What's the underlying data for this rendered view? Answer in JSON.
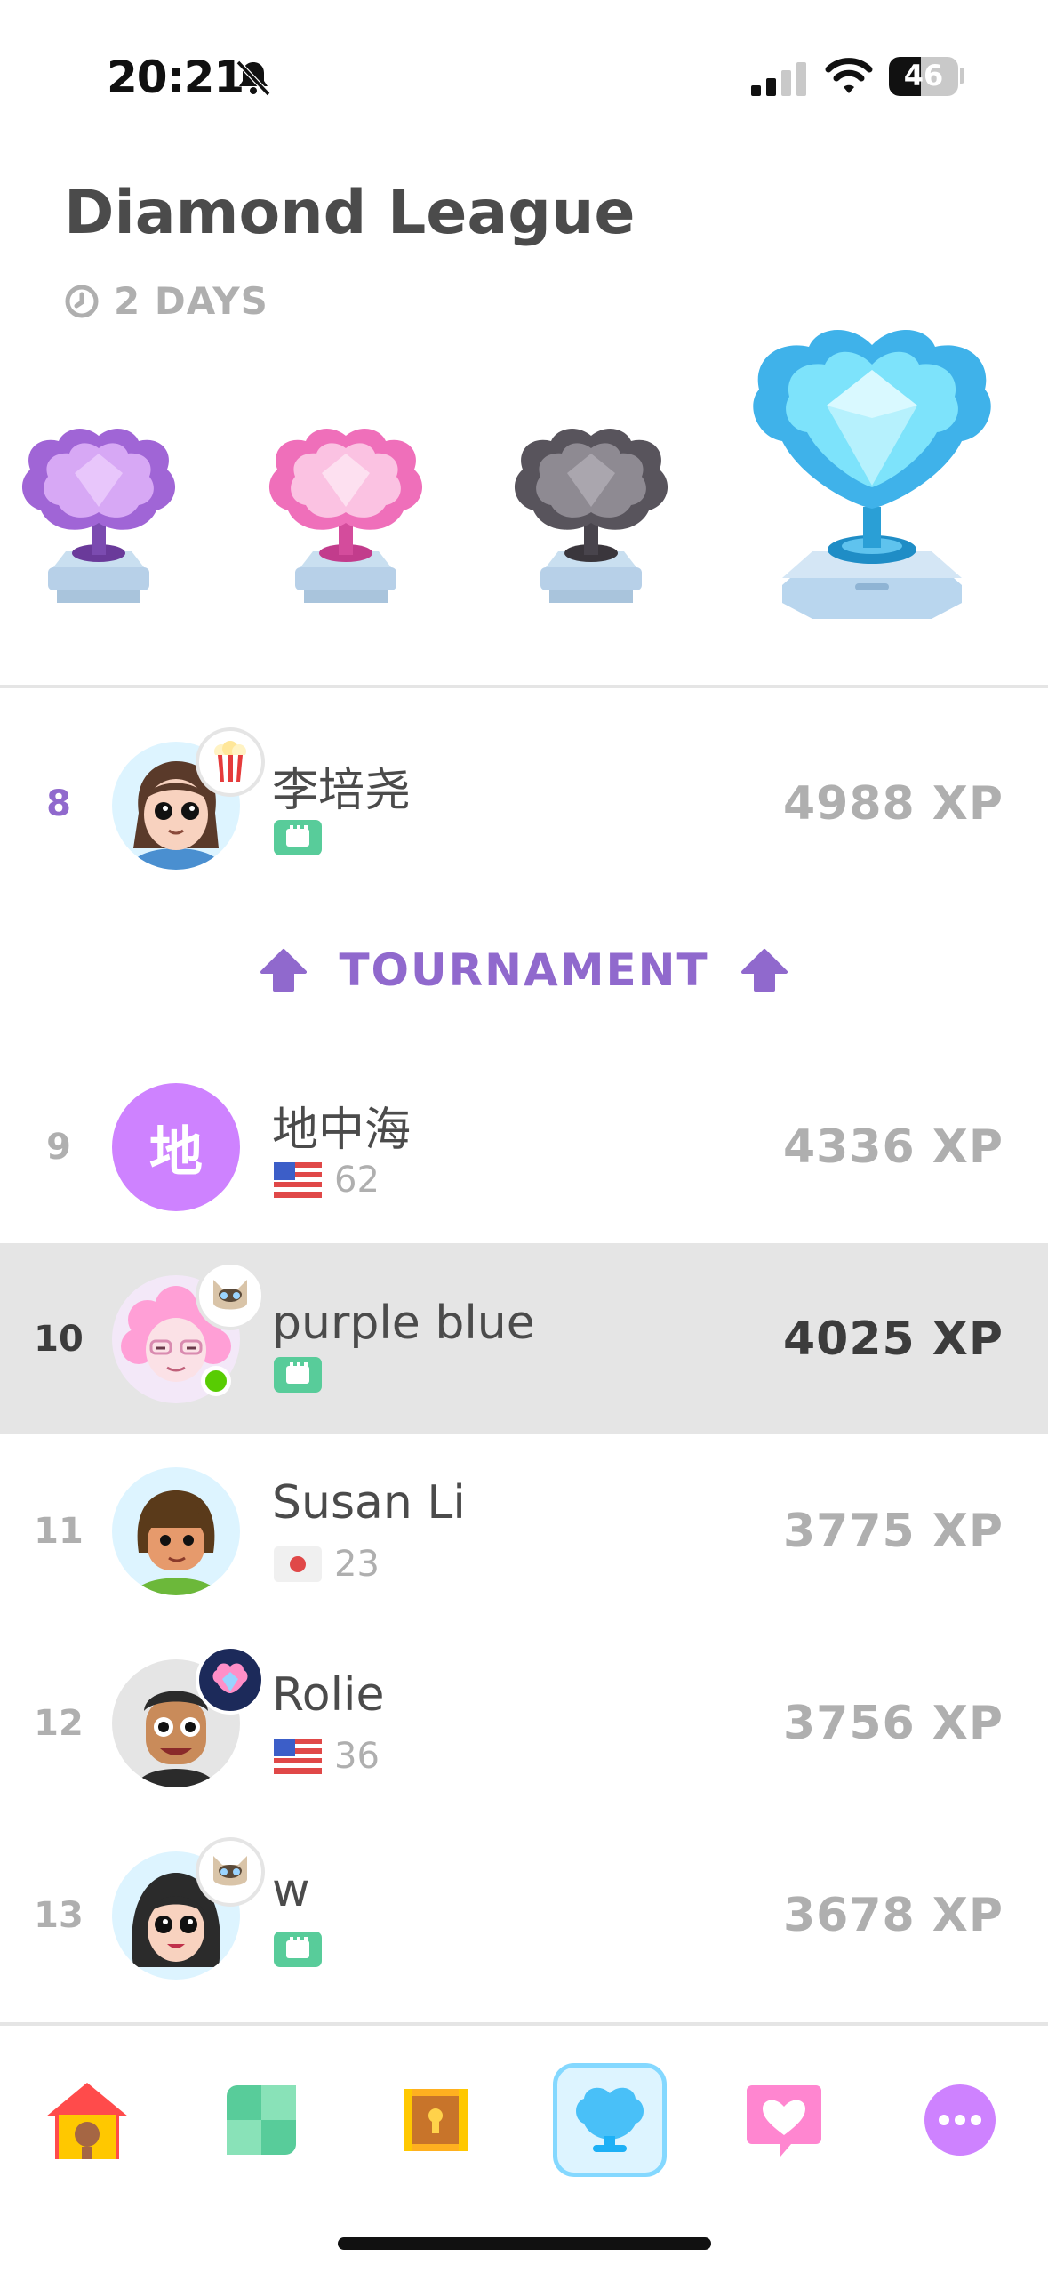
{
  "status_bar": {
    "time": "20:21",
    "battery": "46"
  },
  "league": {
    "title": "Diamond League",
    "timer": "2 DAYS"
  },
  "trophies": [
    "amethyst-trophy",
    "pearl-trophy",
    "obsidian-trophy",
    "diamond-trophy"
  ],
  "leaderboard": {
    "promotion_label": "TOURNAMENT",
    "rows": [
      {
        "rank": "8",
        "name": "李培尧",
        "sub": "",
        "xp": "4988 XP"
      },
      {
        "rank": "9",
        "name": "地中海",
        "sub": "62",
        "xp": "4336 XP",
        "initial": "地"
      },
      {
        "rank": "10",
        "name": "purple blue",
        "sub": "",
        "xp": "4025 XP"
      },
      {
        "rank": "11",
        "name": "Susan Li",
        "sub": "23",
        "xp": "3775 XP"
      },
      {
        "rank": "12",
        "name": "Rolie",
        "sub": "36",
        "xp": "3756 XP"
      },
      {
        "rank": "13",
        "name": "w",
        "sub": "",
        "xp": "3678 XP"
      }
    ]
  },
  "tabs": [
    "home-icon",
    "practice-icon",
    "quests-icon",
    "leaderboards-icon",
    "shop-icon",
    "more-icon"
  ],
  "colors": {
    "accent_purple": "#9069cd",
    "highlight_row": "#e5e5e5",
    "club_green": "#58cc9a",
    "active_tab": "#84d8ff"
  }
}
